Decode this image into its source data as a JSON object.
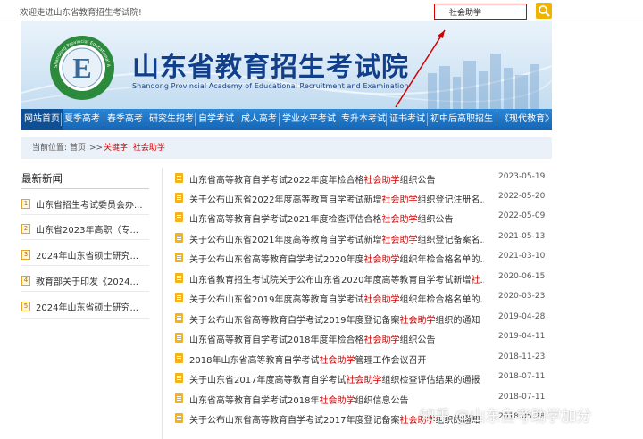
{
  "topbar": {
    "welcome": "欢迎走进山东省教育招生考试院!",
    "search_value": "社会助学"
  },
  "banner": {
    "title": "山东省教育招生考试院",
    "subtitle": "Shandong Provincial Academy of Educational Recruitment and Examination",
    "logo_letter": "E",
    "logo_ring_text": "Shandong Provincial Educational Admission & Examination Authority"
  },
  "nav": [
    "网站首页",
    "夏季高考",
    "春季高考",
    "研究生招考",
    "自学考试",
    "成人高考",
    "学业水平考试",
    "专升本考试",
    "证书考试",
    "初中后高职招生",
    "《现代教育》"
  ],
  "breadcrumb": {
    "label": "当前位置:",
    "home": "首页",
    "separator": ">>",
    "keyword": "关键字: 社会助学"
  },
  "sidebar": {
    "heading": "最新新闻",
    "items": [
      {
        "num": "1",
        "text": "山东省招生考试委员会办..."
      },
      {
        "num": "2",
        "text": "山东省2023年高职（专..."
      },
      {
        "num": "3",
        "text": "2024年山东省硕士研究..."
      },
      {
        "num": "4",
        "text": "教育部关于印发《2024..."
      },
      {
        "num": "5",
        "text": "2024年山东省硕士研究..."
      }
    ]
  },
  "articles": [
    {
      "pre": "山东省高等教育自学考试2022年度年检合格",
      "hl": "社会助学",
      "post": "组织公告",
      "date": "2023-05-19"
    },
    {
      "pre": "关于公布山东省2022年度高等教育自学考试新增",
      "hl": "社会助学",
      "post": "组织登记注册名...",
      "date": "2022-05-20"
    },
    {
      "pre": "山东省高等教育自学考试2021年度检查评估合格",
      "hl": "社会助学",
      "post": "组织公告",
      "date": "2022-05-09"
    },
    {
      "pre": "关于公布山东省2021年度高等教育自学考试新增",
      "hl": "社会助学",
      "post": "组织登记备案名...",
      "date": "2021-05-13"
    },
    {
      "pre": "关于公布山东省高等教育自学考试2020年度",
      "hl": "社会助学",
      "post": "组织年检合格名单的...",
      "date": "2021-03-10"
    },
    {
      "pre": "山东省教育招生考试院关于公布山东省2020年度高等教育自学考试新增",
      "hl": "社",
      "post": "...",
      "date": "2020-06-15"
    },
    {
      "pre": "关于公布山东省2019年度高等教育自学考试",
      "hl": "社会助学",
      "post": "组织年检合格名单的...",
      "date": "2020-03-23"
    },
    {
      "pre": "关于公布山东省高等教育自学考试2019年度登记备案",
      "hl": "社会助学",
      "post": "组织的通知",
      "date": "2019-04-28"
    },
    {
      "pre": "山东省高等教育自学考试2018年度年检合格",
      "hl": "社会助学",
      "post": "组织公告",
      "date": "2019-04-11"
    },
    {
      "pre": "2018年山东省高等教育自学考试",
      "hl": "社会助学",
      "post": "管理工作会议召开",
      "date": "2018-11-23"
    },
    {
      "pre": "关于山东省2017年度高等教育自学考试",
      "hl": "社会助学",
      "post": "组织检查评估结果的通报",
      "date": "2018-07-11"
    },
    {
      "pre": "山东省高等教育自学考试2018年",
      "hl": "社会助学",
      "post": "组织信息公告",
      "date": "2018-07-11"
    },
    {
      "pre": "关于公布山东省高等教育自学考试2017年度登记备案",
      "hl": "社会助学",
      "post": "组织的通知",
      "date": "2018-05-28"
    }
  ],
  "watermark": "知乎 @山东自考助学加分",
  "colors": {
    "nav_blue": "#1565b5",
    "highlight_red": "#cc0000",
    "icon_yellow": "#f3b31d",
    "title_blue": "#123f8a"
  }
}
